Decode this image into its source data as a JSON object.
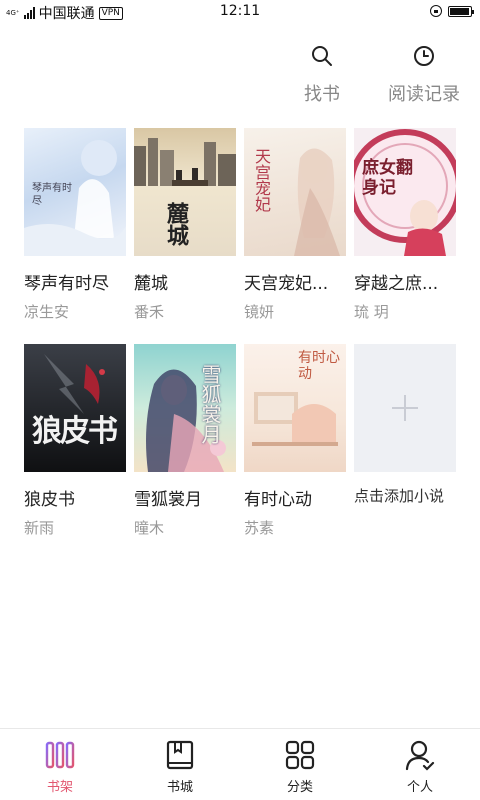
{
  "status_bar": {
    "network": "4G⁺",
    "carrier": "中国联通",
    "vpn": "VPN",
    "time": "12:11",
    "battery_level": 0.95
  },
  "actions": [
    {
      "label": "找书",
      "icon": "search-icon"
    },
    {
      "label": "阅读记录",
      "icon": "clock-icon"
    }
  ],
  "books": [
    {
      "title": "琴声有时尽",
      "author": "凉生安",
      "cover_text": "琴声有时尽"
    },
    {
      "title": "麓城",
      "author": "番禾",
      "cover_text": "麓城"
    },
    {
      "title": "天宫宠妃...",
      "author": "镜妍",
      "cover_text": "天宫宠妃"
    },
    {
      "title": "穿越之庶...",
      "author": "琉 玥",
      "cover_text": "庶女翻身记"
    },
    {
      "title": "狼皮书",
      "author": "新雨",
      "cover_text": "狼皮书"
    },
    {
      "title": "雪狐裳月",
      "author": "曈木",
      "cover_text": "雪狐裳月"
    },
    {
      "title": "有时心动",
      "author": "苏素",
      "cover_text": "有时心动"
    }
  ],
  "add_book": {
    "label": "点击添加小说"
  },
  "nav": [
    {
      "label": "书架",
      "icon": "bookshelf-icon",
      "active": true
    },
    {
      "label": "书城",
      "icon": "book-store-icon",
      "active": false
    },
    {
      "label": "分类",
      "icon": "category-grid-icon",
      "active": false
    },
    {
      "label": "个人",
      "icon": "user-icon",
      "active": false
    }
  ],
  "colors": {
    "accent": "#e2566f",
    "muted": "#999999"
  }
}
